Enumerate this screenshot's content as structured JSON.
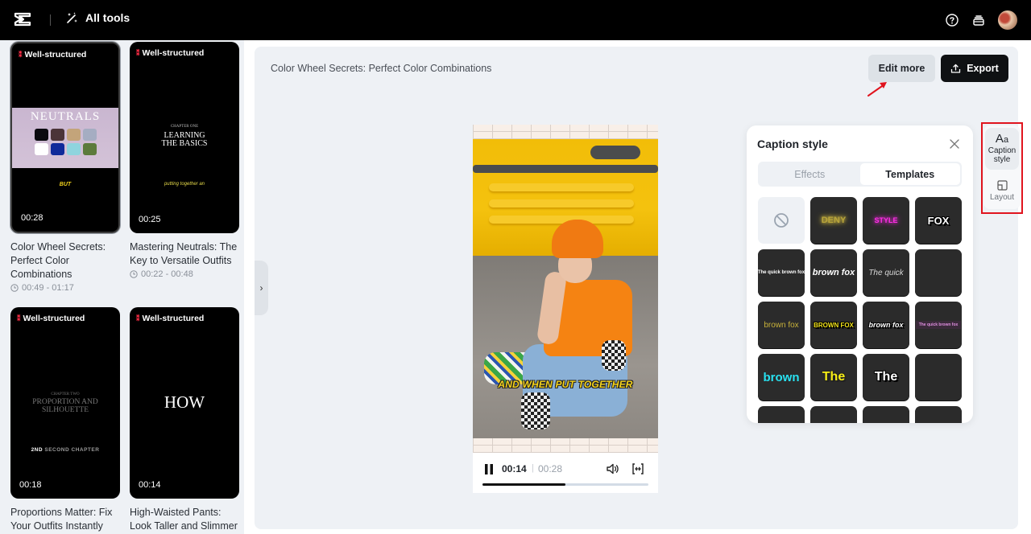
{
  "topbar": {
    "logo_icon": "capcut-logo-icon",
    "all_tools_label": "All tools",
    "all_tools_icon": "magic-wand-icon",
    "help_icon": "help-circle-icon",
    "tray_icon": "inbox-tray-icon",
    "avatar_icon": "user-avatar"
  },
  "sidebar": {
    "clips": [
      {
        "badge": "Well-structured",
        "duration": "00:28",
        "title": "Color Wheel Secrets: Perfect Color Combinations",
        "range": "00:49 - 01:17",
        "thumb_heading": "NEUTRALS",
        "thumb_caption": "BUT",
        "selected": true
      },
      {
        "badge": "Well-structured",
        "duration": "00:25",
        "title": "Mastering Neutrals: The Key to Versatile Outfits",
        "range": "00:22 - 00:48",
        "thumb_kicker": "CHAPTER ONE",
        "thumb_heading": "LEARNING THE BASICS",
        "thumb_caption": "putting together an"
      },
      {
        "badge": "Well-structured",
        "duration": "00:18",
        "title": "Proportions Matter: Fix Your Outfits Instantly",
        "thumb_kicker": "CHAPTER TWO",
        "thumb_heading": "PROPORTION AND SILHOUETTE",
        "thumb_caption_bold": "2ND",
        "thumb_caption": "SECOND CHAPTER"
      },
      {
        "badge": "Well-structured",
        "duration": "00:14",
        "title": "High-Waisted Pants: Look Taller and Slimmer",
        "thumb_heading": "HOW"
      }
    ],
    "swatch_colors": [
      "#0a0a0f",
      "#4b3438",
      "#c3a47a",
      "#a5adc2",
      "#ffffff",
      "#0f2a9a",
      "#8fd4de",
      "#5c7b3c"
    ],
    "collapse_label": "›"
  },
  "main": {
    "video_title": "Color Wheel Secrets: Perfect Color Combinations",
    "edit_more_label": "Edit more",
    "export_label": "Export",
    "export_icon": "upload-icon",
    "annotation_color": "#e0141e",
    "player": {
      "subtitle": "AND WHEN PUT TOGETHER",
      "current_time": "00:14",
      "separator": "|",
      "total_time": "00:28",
      "progress_fraction": 0.5,
      "pause_icon": "pause-icon",
      "volume_icon": "volume-icon",
      "fit_icon": "fit-screen-icon"
    }
  },
  "caption_panel": {
    "title": "Caption style",
    "close_icon": "close-icon",
    "tabs": [
      {
        "label": "Effects",
        "active": false
      },
      {
        "label": "Templates",
        "active": true
      }
    ],
    "templates": [
      {
        "text": "",
        "kind": "none"
      },
      {
        "text": "DENY",
        "color": "#b9a53a",
        "glow": "#d8c040",
        "size": 11
      },
      {
        "text": "STYLE",
        "color": "#ff2ee6",
        "glow": "#e02ad0",
        "size": 9
      },
      {
        "text": "FOX",
        "color": "#ffffff",
        "outline": "#000000",
        "size": 13
      },
      {
        "text": "The quick brown fox",
        "color": "#ffffff",
        "size": 6
      },
      {
        "text": "brown fox",
        "color": "#ffffff",
        "italic": true,
        "size": 11
      },
      {
        "text": "The quick",
        "color": "#d8d8d8",
        "italic": true,
        "size": 10,
        "light": true
      },
      {
        "text": "",
        "kind": "blank"
      },
      {
        "text": "brown fox",
        "color": "#c8b23a",
        "size": 10,
        "light": true
      },
      {
        "text": "BROWN FOX",
        "color": "#f2e31a",
        "outline": "#000000",
        "size": 8
      },
      {
        "text": "brown fox",
        "color": "#ffffff",
        "italic": true,
        "size": 9,
        "outline": "#000000"
      },
      {
        "text": "The quick brown fox",
        "color": "#e08fe0",
        "bg": "#3a2a3a",
        "size": 5
      },
      {
        "text": "brown",
        "color": "#28e1f0",
        "size": 15
      },
      {
        "text": "The",
        "color": "#f7ee16",
        "size": 16,
        "outline": "#222222"
      },
      {
        "text": "The",
        "color": "#ffffff",
        "size": 16,
        "outline": "#000000"
      },
      {
        "text": "",
        "kind": "blank"
      },
      {
        "text": "",
        "kind": "blank"
      },
      {
        "text": "",
        "kind": "blank"
      },
      {
        "text": "",
        "kind": "blank"
      },
      {
        "text": "",
        "kind": "blank"
      }
    ]
  },
  "tool_rail": {
    "items": [
      {
        "label": "Caption style",
        "label_line1": "Caption",
        "label_line2": "style",
        "icon": "text-style-icon",
        "active": true
      },
      {
        "label": "Layout",
        "icon": "layout-icon",
        "active": false
      }
    ],
    "highlight_color": "#e0141e"
  }
}
